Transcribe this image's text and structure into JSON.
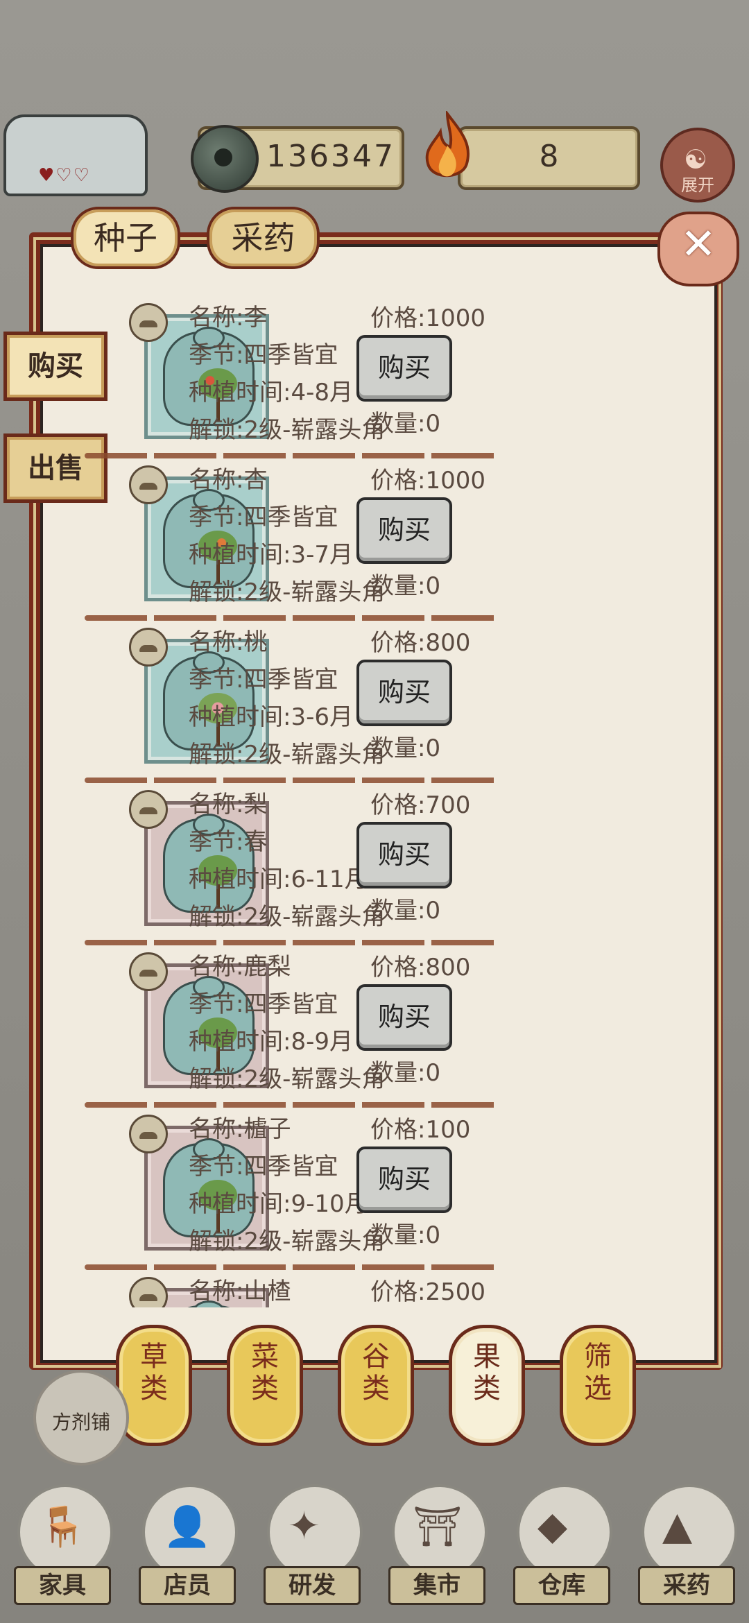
{
  "hud": {
    "coins": "136347",
    "fire": "8",
    "expand_label": "展开"
  },
  "top_tabs": [
    "种子",
    "采药"
  ],
  "side_buttons": {
    "buy": "购买",
    "sell": "出售"
  },
  "items": [
    {
      "name": "名称:李",
      "season": "季节:四季皆宜",
      "time": "种植时间:4-8月",
      "unlock": "解锁:2级-崭露头角",
      "price": "价格:1000",
      "buy": "购买",
      "qty": "数量:0",
      "bag_color": "blue",
      "fruit": "red"
    },
    {
      "name": "名称:杏",
      "season": "季节:四季皆宜",
      "time": "种植时间:3-7月",
      "unlock": "解锁:2级-崭露头角",
      "price": "价格:1000",
      "buy": "购买",
      "qty": "数量:0",
      "bag_color": "blue",
      "fruit": "orange"
    },
    {
      "name": "名称:桃",
      "season": "季节:四季皆宜",
      "time": "种植时间:3-6月",
      "unlock": "解锁:2级-崭露头角",
      "price": "价格:800",
      "buy": "购买",
      "qty": "数量:0",
      "bag_color": "blue",
      "fruit": "pinkf"
    },
    {
      "name": "名称:梨",
      "season": "季节:春",
      "time": "种植时间:6-11月",
      "unlock": "解锁:2级-崭露头角",
      "price": "价格:700",
      "buy": "购买",
      "qty": "数量:0",
      "bag_color": "pink",
      "fruit": "green"
    },
    {
      "name": "名称:鹿梨",
      "season": "季节:四季皆宜",
      "time": "种植时间:8-9月",
      "unlock": "解锁:2级-崭露头角",
      "price": "价格:800",
      "buy": "购买",
      "qty": "数量:0",
      "bag_color": "pink",
      "fruit": "green"
    },
    {
      "name": "名称:樝子",
      "season": "季节:四季皆宜",
      "time": "种植时间:9-10月",
      "unlock": "解锁:2级-崭露头角",
      "price": "价格:100",
      "buy": "购买",
      "qty": "数量:0",
      "bag_color": "pink",
      "fruit": "green"
    },
    {
      "name": "名称:山楂",
      "season": "",
      "time": "",
      "unlock": "",
      "price": "价格:2500",
      "buy": "",
      "qty": "",
      "bag_color": "pink",
      "fruit": "green"
    }
  ],
  "categories": [
    {
      "label": "草类",
      "active": false
    },
    {
      "label": "菜类",
      "active": false
    },
    {
      "label": "谷类",
      "active": false
    },
    {
      "label": "果类",
      "active": true
    },
    {
      "label": "筛选",
      "active": false
    }
  ],
  "shop_bubble": "方剂铺",
  "bottom_nav": [
    {
      "label": "家具",
      "icon": "chair-icon",
      "glyph": "🪑"
    },
    {
      "label": "店员",
      "icon": "clerk-icon",
      "glyph": "👤"
    },
    {
      "label": "研发",
      "icon": "research-icon",
      "glyph": "✦"
    },
    {
      "label": "集市",
      "icon": "market-icon",
      "glyph": "⛩"
    },
    {
      "label": "仓库",
      "icon": "warehouse-icon",
      "glyph": "◆"
    },
    {
      "label": "采药",
      "icon": "mountain-icon",
      "glyph": "▲"
    }
  ]
}
